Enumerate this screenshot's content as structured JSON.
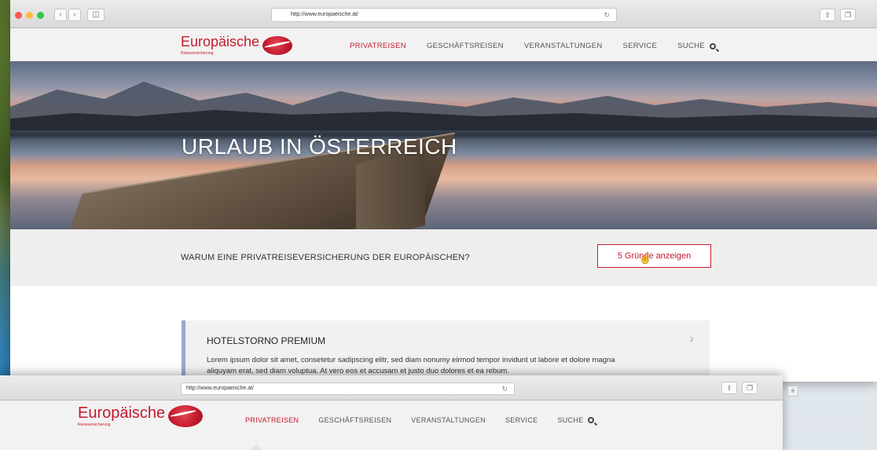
{
  "window_top": {
    "url": "http://www.europaeische.at/",
    "brand": {
      "name": "Europäische",
      "tagline": "Reiseversicherung"
    },
    "nav": [
      {
        "label": "PRIVATREISEN",
        "active": true
      },
      {
        "label": "GESCHÄFTSREISEN",
        "active": false
      },
      {
        "label": "VERANSTALTUNGEN",
        "active": false
      },
      {
        "label": "SERVICE",
        "active": false
      },
      {
        "label": "SUCHE",
        "active": false
      }
    ],
    "hero_title": "URLAUB IN ÖSTERREICH",
    "band": {
      "question": "WARUM EINE PRIVATREISEVERSICHERUNG DER EUROPÄISCHEN?",
      "cta_label": "5 Gründe anzeigen"
    },
    "card": {
      "title": "HOTELSTORNO PREMIUM",
      "body": "Lorem ipsum dolor sit amet, consetetur sadipscing elitr, sed diam nonumy eirmod tempor invidunt ut labore et dolore magna aliquyam erat, sed diam voluptua. At vero eos et accusam et justo duo dolores et ea rebum."
    }
  },
  "window_bottom": {
    "url": "http://www.europaeische.at/",
    "brand": {
      "name": "Europäische",
      "tagline": "Reiseversicherung"
    },
    "nav": [
      {
        "label": "PRIVATREISEN",
        "active": true
      },
      {
        "label": "GESCHÄFTSREISEN",
        "active": false
      },
      {
        "label": "VERANSTALTUNGEN",
        "active": false
      },
      {
        "label": "SERVICE",
        "active": false
      },
      {
        "label": "SUCHE",
        "active": false
      }
    ]
  },
  "colors": {
    "brand_red": "#c51b2e",
    "card_accent": "#9aa8d1"
  },
  "icons": {
    "search": "search-icon",
    "chevron": "chevron-right-icon",
    "reload": "reload-icon",
    "share": "share-icon",
    "tabs": "tabs-icon"
  }
}
